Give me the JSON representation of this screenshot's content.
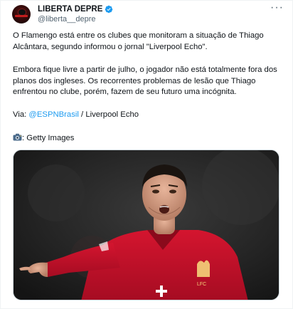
{
  "author": {
    "display_name": "LIBERTA DEPRE",
    "handle": "@liberta__depre",
    "verified": true,
    "avatar_logo_text": "Liberta Depre"
  },
  "menu_icon": "more-dots-icon",
  "post": {
    "paragraph_1": "O Flamengo está entre os clubes que monitoram a situação de Thiago Alcântara, segundo informou o jornal \"Liverpool Echo\".",
    "paragraph_2": "Embora fique livre a partir de julho, o jogador não está totalmente fora dos planos dos ingleses. Os recorrentes problemas de lesão que Thiago enfrentou no clube, porém, fazem de seu futuro uma incógnita.",
    "via_prefix": "Via: ",
    "via_mention": "@ESPNBrasil",
    "via_separator": " /  ",
    "via_source": "Liverpool Echo",
    "credit_icon": "camera-icon",
    "credit_text": ": Getty Images"
  },
  "media": {
    "description_icon": "photo-player-pointing",
    "shirt_color": "#c8102e",
    "sponsor_mark": "+"
  },
  "colors": {
    "link": "#1d9bf0",
    "verified": "#1d9bf0",
    "secondary_text": "#536471"
  }
}
